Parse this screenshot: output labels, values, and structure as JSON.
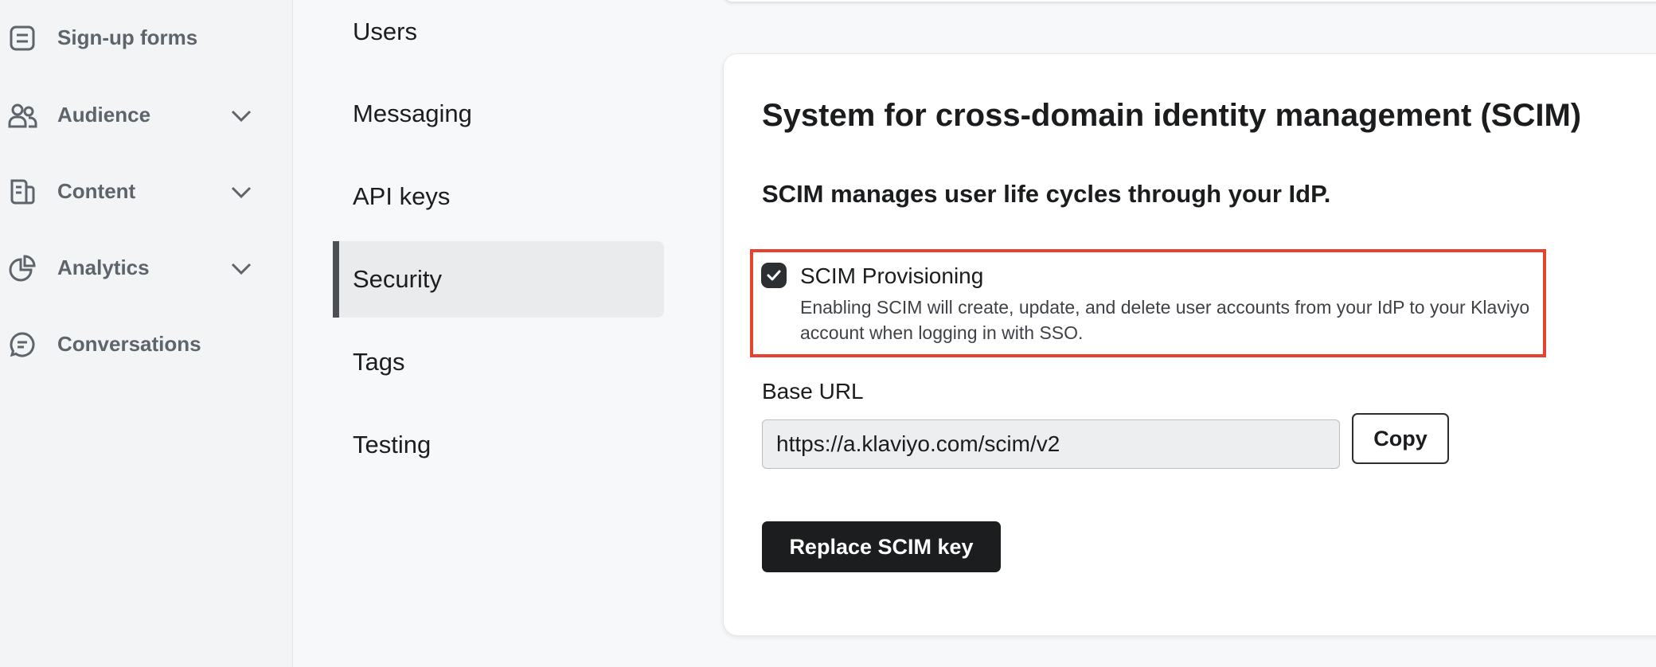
{
  "sidebar": {
    "items": [
      {
        "label": "Sign-up forms",
        "icon": "form-icon"
      },
      {
        "label": "Audience",
        "icon": "users-icon",
        "expandable": true
      },
      {
        "label": "Content",
        "icon": "content-icon",
        "expandable": true
      },
      {
        "label": "Analytics",
        "icon": "chart-pie-icon",
        "expandable": true
      },
      {
        "label": "Conversations",
        "icon": "chat-icon"
      }
    ]
  },
  "settings_nav": {
    "items": [
      {
        "label": "Users"
      },
      {
        "label": "Messaging"
      },
      {
        "label": "API keys"
      },
      {
        "label": "Security",
        "active": true
      },
      {
        "label": "Tags"
      },
      {
        "label": "Testing"
      }
    ]
  },
  "scim_card": {
    "title": "System for cross-domain identity management (SCIM)",
    "subtitle": "SCIM manages user life cycles through your IdP.",
    "provisioning": {
      "label": "SCIM Provisioning",
      "checked": true,
      "description": "Enabling SCIM will create, update, and delete user accounts from your IdP to your Klaviyo account when logging in with SSO."
    },
    "base_url": {
      "label": "Base URL",
      "value": "https://a.klaviyo.com/scim/v2"
    },
    "copy_label": "Copy",
    "replace_label": "Replace SCIM key"
  },
  "colors": {
    "highlight": "#e5432f",
    "primary_button": "#1c1d1f",
    "active_nav_bg": "#e9ebed"
  }
}
